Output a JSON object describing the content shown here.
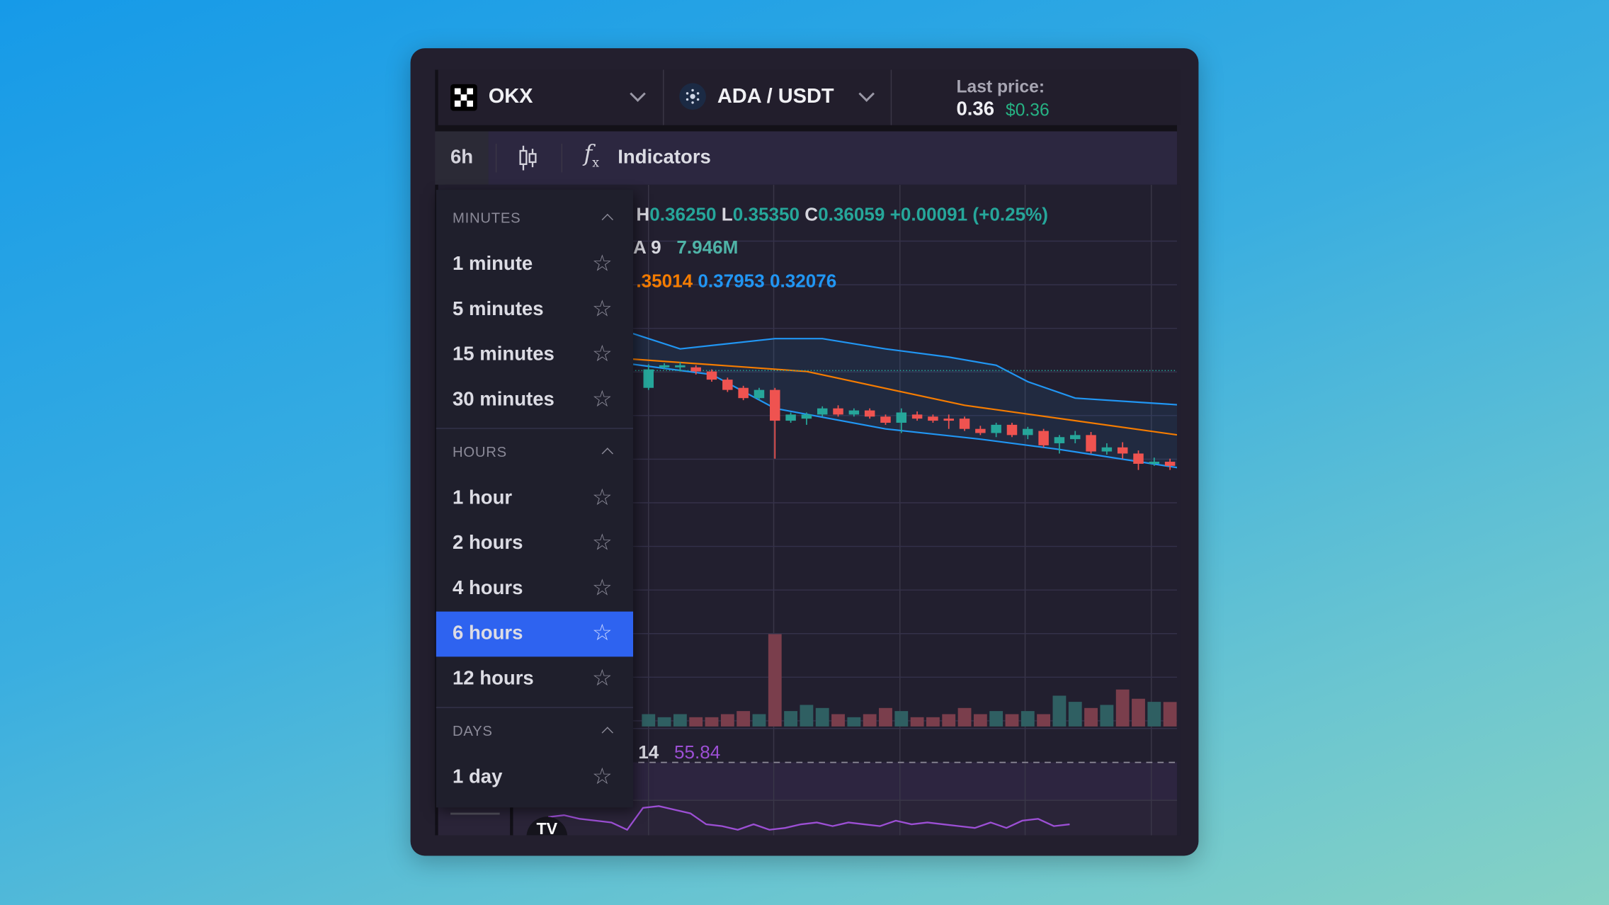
{
  "header": {
    "exchange": "OKX",
    "pair": "ADA / USDT",
    "last_price_label": "Last price:",
    "last_price": "0.36",
    "last_price_usd": "$0.36"
  },
  "toolbar": {
    "interval": "6h",
    "chart_type_icon": "candlestick-icon",
    "indicators_label": "Indicators"
  },
  "legend": {
    "ohlc": {
      "h_label": "H",
      "h": "0.36250",
      "l_label": "L",
      "l": "0.35350",
      "c_label": "C",
      "c": "0.36059",
      "change": "+0.00091 (+0.25%)"
    },
    "volume": {
      "label": "A 9",
      "value": "7.946M"
    },
    "bollinger": {
      "basis": ".35014",
      "upper": "0.37953",
      "lower": "0.32076"
    },
    "rsi": {
      "label": "14",
      "value": "55.84"
    }
  },
  "interval_menu": {
    "sections": [
      {
        "title": "MINUTES",
        "items": [
          "1 minute",
          "5 minutes",
          "15 minutes",
          "30 minutes"
        ]
      },
      {
        "title": "HOURS",
        "items": [
          "1 hour",
          "2 hours",
          "4 hours",
          "6 hours",
          "12 hours"
        ]
      },
      {
        "title": "DAYS",
        "items": [
          "1 day"
        ]
      }
    ],
    "selected": "6 hours"
  },
  "logo_text": "TV",
  "colors": {
    "up": "#26a69a",
    "down": "#ef5350",
    "ma": "#f57c00",
    "bands": "#2196f3",
    "rsi": "#9c4fd4",
    "selected": "#2e63f0",
    "last_price_usd": "#26b384"
  },
  "chart_data": {
    "type": "candlestick",
    "last_close": 0.36059,
    "candles": [
      [
        0.3589,
        0.3612,
        0.3587,
        0.3607
      ],
      [
        0.3609,
        0.3613,
        0.3607,
        0.3611
      ],
      [
        0.3609,
        0.3614,
        0.3605,
        0.3611
      ],
      [
        0.3609,
        0.3611,
        0.3602,
        0.3605
      ],
      [
        0.3605,
        0.3607,
        0.3595,
        0.3597
      ],
      [
        0.3597,
        0.3599,
        0.3585,
        0.3587
      ],
      [
        0.3589,
        0.3591,
        0.3577,
        0.3579
      ],
      [
        0.3579,
        0.3589,
        0.3577,
        0.3587
      ],
      [
        0.3587,
        0.3589,
        0.352,
        0.3557
      ],
      [
        0.3557,
        0.3565,
        0.3555,
        0.3563
      ],
      [
        0.3559,
        0.3565,
        0.3553,
        0.3563
      ],
      [
        0.3563,
        0.3571,
        0.3561,
        0.3569
      ],
      [
        0.3569,
        0.3572,
        0.3561,
        0.3563
      ],
      [
        0.3563,
        0.3569,
        0.3561,
        0.3567
      ],
      [
        0.3567,
        0.3569,
        0.3559,
        0.3561
      ],
      [
        0.3561,
        0.3563,
        0.3553,
        0.3555
      ],
      [
        0.3555,
        0.3569,
        0.3545,
        0.3565
      ],
      [
        0.3563,
        0.3566,
        0.3557,
        0.3559
      ],
      [
        0.3561,
        0.3563,
        0.3555,
        0.3557
      ],
      [
        0.3559,
        0.3563,
        0.3549,
        0.3557
      ],
      [
        0.3559,
        0.3561,
        0.3547,
        0.3549
      ],
      [
        0.3549,
        0.3552,
        0.3543,
        0.3545
      ],
      [
        0.3545,
        0.3555,
        0.3541,
        0.3553
      ],
      [
        0.3553,
        0.3555,
        0.3541,
        0.3543
      ],
      [
        0.3543,
        0.3551,
        0.3539,
        0.3549
      ],
      [
        0.3547,
        0.3549,
        0.3531,
        0.3533
      ],
      [
        0.3535,
        0.3543,
        0.3525,
        0.3541
      ],
      [
        0.3539,
        0.3547,
        0.3535,
        0.3543
      ],
      [
        0.3543,
        0.3546,
        0.3525,
        0.3527
      ],
      [
        0.3527,
        0.3535,
        0.3524,
        0.3531
      ],
      [
        0.3531,
        0.3536,
        0.352,
        0.3525
      ],
      [
        0.3525,
        0.3528,
        0.3509,
        0.3515
      ],
      [
        0.3515,
        0.3521,
        0.3513,
        0.3517
      ],
      [
        0.3517,
        0.352,
        0.3509,
        0.3513
      ]
    ],
    "volume_m": [
      4,
      3,
      4,
      3,
      3,
      4,
      5,
      4,
      30,
      5,
      7,
      6,
      4,
      3,
      4,
      6,
      5,
      3,
      3,
      4,
      6,
      4,
      5,
      4,
      5,
      4,
      10,
      8,
      6,
      7,
      12,
      9,
      8,
      7.946
    ],
    "bb_upper": [
      [
        -1,
        0.3642
      ],
      [
        2,
        0.3627
      ],
      [
        8,
        0.3637
      ],
      [
        11,
        0.3637
      ],
      [
        15,
        0.3627
      ],
      [
        19,
        0.3619
      ],
      [
        22,
        0.3611
      ],
      [
        24,
        0.3595
      ],
      [
        27,
        0.3579
      ],
      [
        31,
        0.3575
      ],
      [
        34,
        0.3572
      ]
    ],
    "bb_basis": [
      [
        -1,
        0.3617
      ],
      [
        10,
        0.3605
      ],
      [
        20,
        0.3572
      ],
      [
        34,
        0.3542
      ]
    ],
    "bb_lower": [
      [
        -1,
        0.3612
      ],
      [
        4,
        0.3602
      ],
      [
        8,
        0.3569
      ],
      [
        15,
        0.3549
      ],
      [
        21,
        0.3539
      ],
      [
        26,
        0.3529
      ],
      [
        34,
        0.351
      ]
    ],
    "rsi": [
      40,
      41,
      39,
      38,
      37,
      33,
      45,
      46,
      44,
      42,
      36,
      35,
      33,
      36,
      33,
      34,
      36,
      37,
      35,
      37,
      36,
      35,
      38,
      36,
      37,
      36,
      35,
      34,
      37,
      34,
      38,
      39,
      35,
      36
    ]
  }
}
